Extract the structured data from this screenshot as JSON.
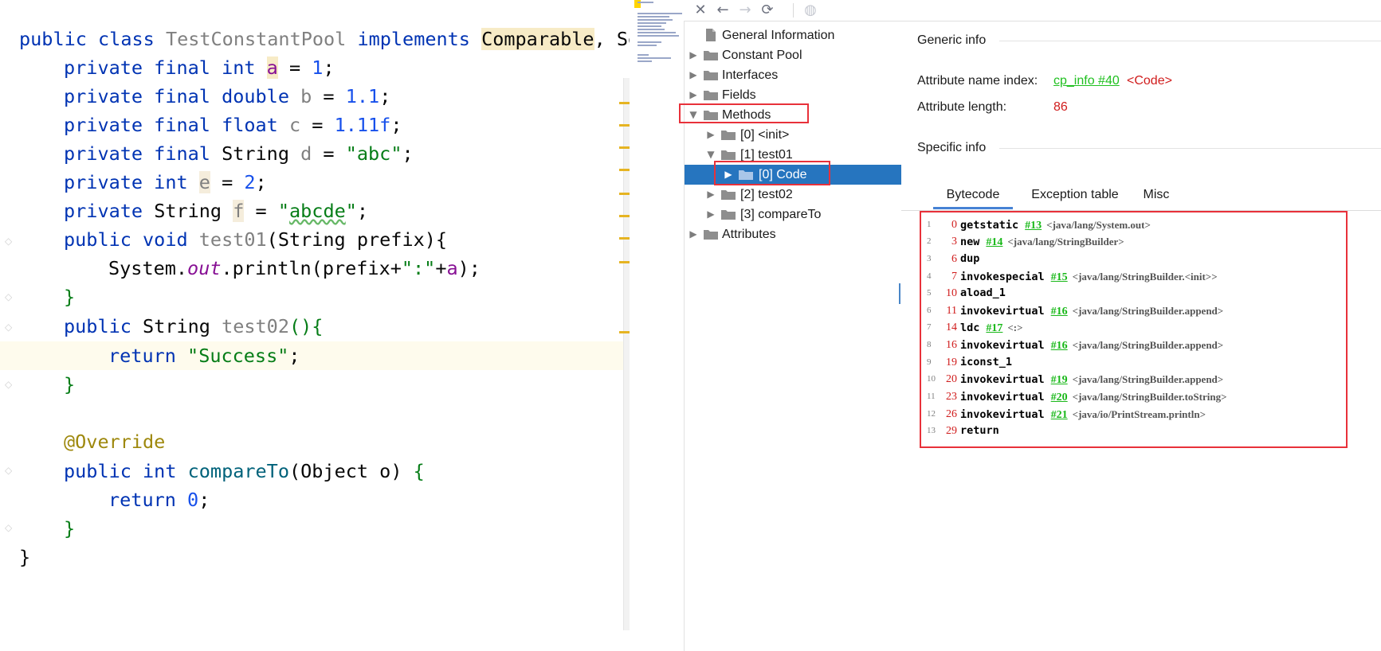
{
  "editor": {
    "lines": [
      {
        "kind": "class_decl",
        "tokens": [
          "public class ",
          "TestConstantPool",
          " implements ",
          "Comparable",
          ", Se"
        ]
      },
      {
        "kind": "field",
        "tokens": [
          "private final int ",
          "a",
          " = ",
          "1",
          ";"
        ]
      },
      {
        "kind": "field",
        "tokens": [
          "private final double ",
          "b",
          " = ",
          "1.1",
          ";"
        ]
      },
      {
        "kind": "field",
        "tokens": [
          "private final float ",
          "c",
          " = ",
          "1.11f",
          ";"
        ]
      },
      {
        "kind": "field",
        "tokens": [
          "private final ",
          "String",
          " ",
          "d",
          " = ",
          "\"abc\"",
          ";"
        ]
      },
      {
        "kind": "field",
        "tokens": [
          "private int ",
          "e",
          " = ",
          "2",
          ";"
        ]
      },
      {
        "kind": "field",
        "tokens": [
          "private ",
          "String",
          " ",
          "f",
          " = ",
          "\"",
          "abcde",
          "\"",
          ";"
        ]
      },
      {
        "kind": "method",
        "tokens": [
          "public void ",
          "test01",
          "(String prefix){"
        ]
      },
      {
        "kind": "stmt",
        "tokens": [
          "System.",
          "out",
          ".println(prefix+",
          "\":\"",
          "+",
          "a",
          ");"
        ]
      },
      {
        "kind": "close",
        "tokens": [
          "}"
        ]
      },
      {
        "kind": "method",
        "tokens": [
          "public ",
          "String",
          " ",
          "test02",
          "(){"
        ]
      },
      {
        "kind": "stmt",
        "tokens": [
          "return ",
          "\"Success\"",
          ";"
        ]
      },
      {
        "kind": "close",
        "tokens": [
          "}"
        ]
      },
      {
        "kind": "blank",
        "tokens": [
          ""
        ]
      },
      {
        "kind": "anno",
        "tokens": [
          "@Override"
        ]
      },
      {
        "kind": "method",
        "tokens": [
          "public int ",
          "compareTo",
          "(Object o) ",
          "{"
        ]
      },
      {
        "kind": "stmt",
        "tokens": [
          "return ",
          "0",
          ";"
        ]
      },
      {
        "kind": "close",
        "tokens": [
          "}"
        ]
      },
      {
        "kind": "close_class",
        "tokens": [
          "}"
        ]
      }
    ]
  },
  "toolbar": {
    "close_icon": "close-icon",
    "back_icon": "arrow-left-icon",
    "forward_icon": "arrow-right-icon",
    "refresh_icon": "refresh-icon",
    "web_icon": "globe-icon"
  },
  "tree": {
    "items": [
      {
        "label": "General Information",
        "icon": "file-icon",
        "expanded": null,
        "selected": false
      },
      {
        "label": "Constant Pool",
        "icon": "folder-icon",
        "expanded": false,
        "selected": false
      },
      {
        "label": "Interfaces",
        "icon": "folder-icon",
        "expanded": false,
        "selected": false
      },
      {
        "label": "Fields",
        "icon": "folder-icon",
        "expanded": false,
        "selected": false
      },
      {
        "label": "Methods",
        "icon": "folder-icon",
        "expanded": true,
        "selected": false
      },
      {
        "label": "[0] <init>",
        "icon": "folder-icon",
        "expanded": false,
        "selected": false
      },
      {
        "label": "[1] test01",
        "icon": "folder-icon",
        "expanded": true,
        "selected": false
      },
      {
        "label": "[0] Code",
        "icon": "folder-icon",
        "expanded": false,
        "selected": true
      },
      {
        "label": "[2] test02",
        "icon": "folder-icon",
        "expanded": false,
        "selected": false
      },
      {
        "label": "[3] compareTo",
        "icon": "folder-icon",
        "expanded": false,
        "selected": false
      },
      {
        "label": "Attributes",
        "icon": "folder-icon",
        "expanded": false,
        "selected": false
      }
    ]
  },
  "details": {
    "generic_title": "Generic info",
    "attr_name_label": "Attribute name index:",
    "attr_name_link": "cp_info #40",
    "attr_name_value": "<Code>",
    "attr_length_label": "Attribute length:",
    "attr_length_value": "86",
    "specific_title": "Specific info",
    "tabs": [
      "Bytecode",
      "Exception table",
      "Misc"
    ],
    "active_tab": "Bytecode"
  },
  "bytecode": [
    {
      "line": "1",
      "offset": "0",
      "op": "getstatic",
      "ref": "#13",
      "comment": "<java/lang/System.out>"
    },
    {
      "line": "2",
      "offset": "3",
      "op": "new",
      "ref": "#14",
      "comment": "<java/lang/StringBuilder>"
    },
    {
      "line": "3",
      "offset": "6",
      "op": "dup",
      "ref": "",
      "comment": ""
    },
    {
      "line": "4",
      "offset": "7",
      "op": "invokespecial",
      "ref": "#15",
      "comment": "<java/lang/StringBuilder.<init>>"
    },
    {
      "line": "5",
      "offset": "10",
      "op": "aload_1",
      "ref": "",
      "comment": ""
    },
    {
      "line": "6",
      "offset": "11",
      "op": "invokevirtual",
      "ref": "#16",
      "comment": "<java/lang/StringBuilder.append>"
    },
    {
      "line": "7",
      "offset": "14",
      "op": "ldc",
      "ref": "#17",
      "comment": "<:>"
    },
    {
      "line": "8",
      "offset": "16",
      "op": "invokevirtual",
      "ref": "#16",
      "comment": "<java/lang/StringBuilder.append>"
    },
    {
      "line": "9",
      "offset": "19",
      "op": "iconst_1",
      "ref": "",
      "comment": ""
    },
    {
      "line": "10",
      "offset": "20",
      "op": "invokevirtual",
      "ref": "#19",
      "comment": "<java/lang/StringBuilder.append>"
    },
    {
      "line": "11",
      "offset": "23",
      "op": "invokevirtual",
      "ref": "#20",
      "comment": "<java/lang/StringBuilder.toString>"
    },
    {
      "line": "12",
      "offset": "26",
      "op": "invokevirtual",
      "ref": "#21",
      "comment": "<java/io/PrintStream.println>"
    },
    {
      "line": "13",
      "offset": "29",
      "op": "return",
      "ref": "",
      "comment": ""
    }
  ],
  "colors": {
    "selection": "#2675bf",
    "highlight_box": "#e8313a",
    "link": "#20c020",
    "value_red": "#d01c1c"
  }
}
